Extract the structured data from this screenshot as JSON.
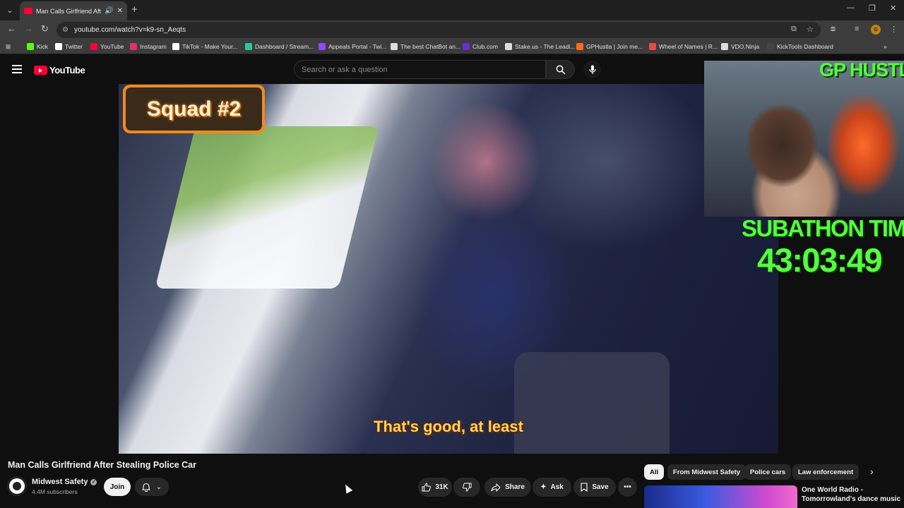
{
  "browser": {
    "tab_title": "Man Calls Girlfriend After St",
    "url": "youtube.com/watch?v=k9-sn_Aeqts",
    "bookmarks": [
      {
        "label": "Kick",
        "icon": "kick-icon",
        "color": "#53fc18"
      },
      {
        "label": "Twitter",
        "icon": "x-icon",
        "color": "#ffffff"
      },
      {
        "label": "YouTube",
        "icon": "youtube-icon",
        "color": "#ff0033"
      },
      {
        "label": "Instagram",
        "icon": "instagram-icon",
        "color": "#e1306c"
      },
      {
        "label": "TikTok - Make Your...",
        "icon": "tiktok-icon",
        "color": "#ffffff"
      },
      {
        "label": "Dashboard / Stream...",
        "icon": "streamelements-icon",
        "color": "#27c99a"
      },
      {
        "label": "Appeals Portal - Twi...",
        "icon": "twitch-icon",
        "color": "#9146ff"
      },
      {
        "label": "The best ChatBot an...",
        "icon": "chatbot-icon",
        "color": "#dddddd"
      },
      {
        "label": "Club.com",
        "icon": "club-icon",
        "color": "#6b2bd9"
      },
      {
        "label": "Stake.us - The Leadi...",
        "icon": "stake-icon",
        "color": "#dddddd"
      },
      {
        "label": "GPHustla | Join me...",
        "icon": "gphustla-icon",
        "color": "#ff6a1a"
      },
      {
        "label": "Wheel of Names | R...",
        "icon": "wheel-icon",
        "color": "#e94b3c"
      },
      {
        "label": "VDO.Ninja",
        "icon": "vdo-ninja-icon",
        "color": "#dddddd"
      },
      {
        "label": "KickTools Dashboard",
        "icon": "kicktools-icon",
        "color": "#444444"
      }
    ]
  },
  "youtube": {
    "logo_text": "YouTube",
    "search_placeholder": "Search or ask a question"
  },
  "video": {
    "overlay_badge": "Squad #2",
    "caption": "That's good, at least",
    "stream_name": "GP HUSTLA",
    "subathon_label": "SUBATHON TIMER",
    "subathon_time": "43:03:49"
  },
  "info": {
    "title": "Man Calls Girlfriend After Stealing Police Car",
    "channel": "Midwest Safety",
    "subscribers": "4.4M subscribers",
    "join_label": "Join",
    "likes": "31K",
    "share_label": "Share",
    "ask_label": "Ask",
    "save_label": "Save"
  },
  "chips": [
    "All",
    "From Midwest Safety",
    "Police cars",
    "Law enforcement"
  ],
  "recommendation": {
    "title": "One World Radio - Tomorrowland's dance music"
  }
}
